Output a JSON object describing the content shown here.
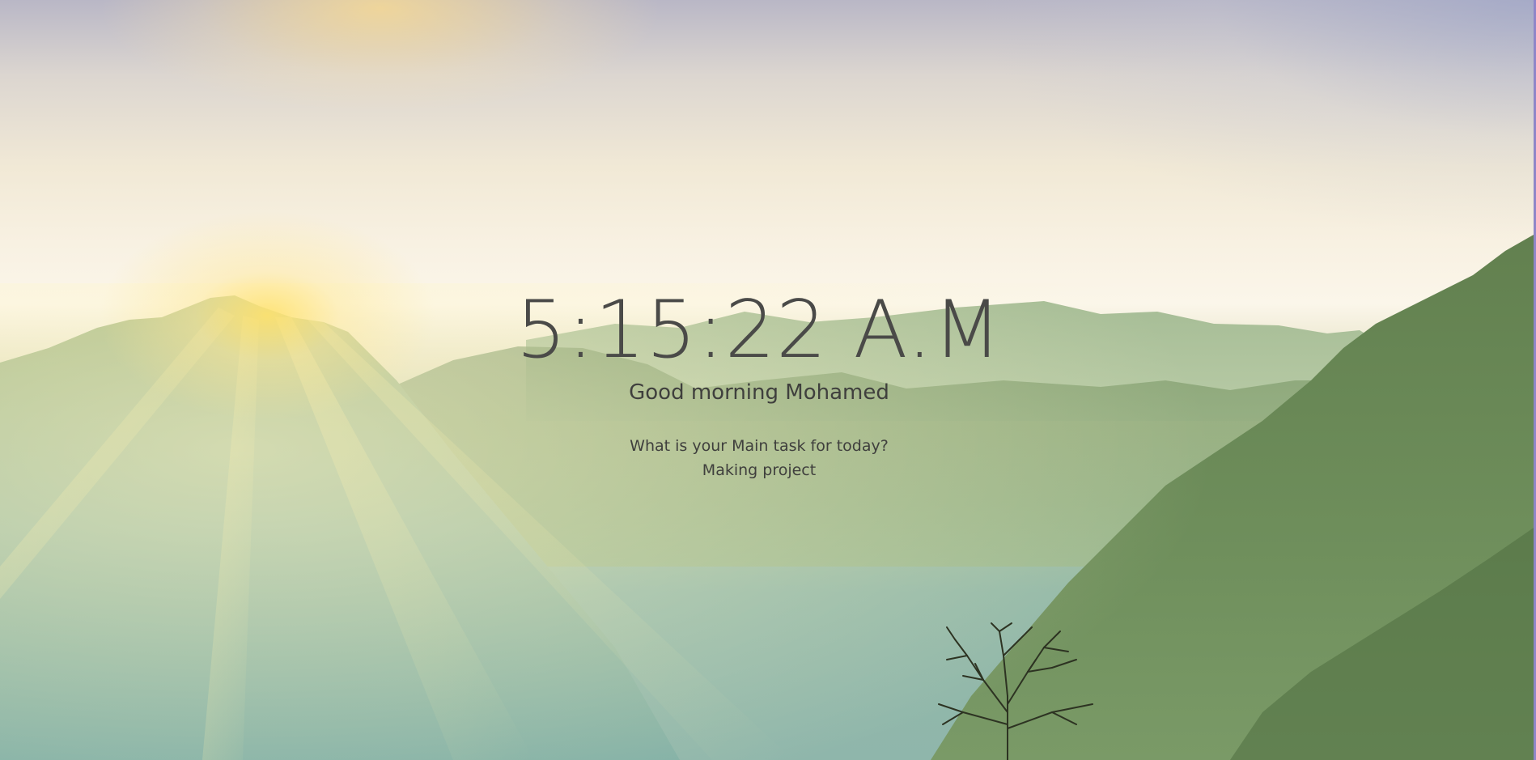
{
  "clock": {
    "time": "5:15:22 A.M"
  },
  "greeting": {
    "text": "Good morning Mohamed"
  },
  "focus": {
    "question": "What is your Main task for today?",
    "value": "Making project"
  },
  "background": {
    "description_colors": {
      "sky_top": "#b9b7c6",
      "sky_mid": "#f8f1e2",
      "mountain_dark": "#5c7a4e",
      "mountain_mid": "#8aa77a",
      "valley": "#8fb6ab",
      "sun": "#ffde70"
    }
  }
}
